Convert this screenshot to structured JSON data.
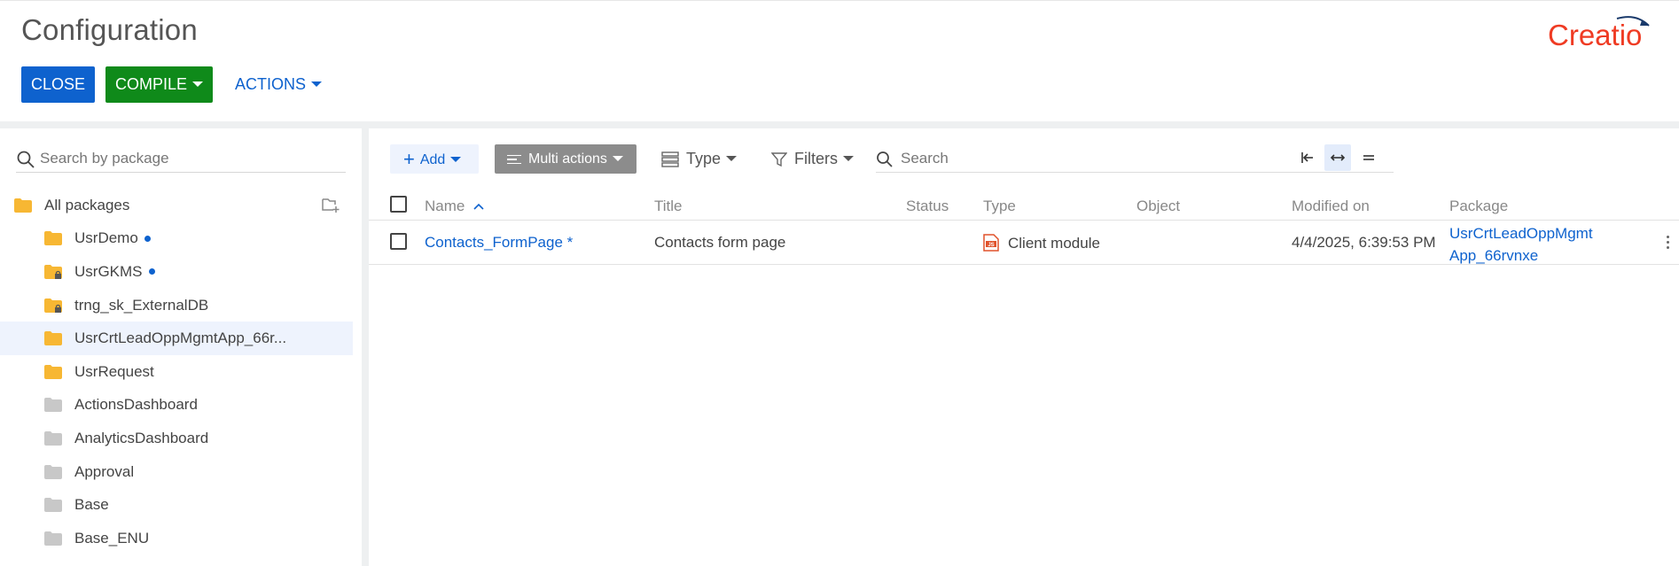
{
  "header": {
    "title": "Configuration",
    "close_label": "CLOSE",
    "compile_label": "COMPILE",
    "actions_label": "ACTIONS",
    "logo_text": "Creatio"
  },
  "sidebar": {
    "search_placeholder": "Search by package",
    "all_packages_label": "All packages",
    "packages": [
      {
        "name": "UsrDemo",
        "dot": true,
        "locked": false,
        "color": "orange",
        "selected": false
      },
      {
        "name": "UsrGKMS",
        "dot": true,
        "locked": true,
        "color": "orange",
        "selected": false
      },
      {
        "name": "trng_sk_ExternalDB",
        "dot": false,
        "locked": true,
        "color": "orange",
        "selected": false
      },
      {
        "name": "UsrCrtLeadOppMgmtApp_66r...",
        "dot": false,
        "locked": false,
        "color": "orange",
        "selected": true
      },
      {
        "name": "UsrRequest",
        "dot": false,
        "locked": false,
        "color": "orange",
        "selected": false
      },
      {
        "name": "ActionsDashboard",
        "dot": false,
        "locked": false,
        "color": "gray",
        "selected": false
      },
      {
        "name": "AnalyticsDashboard",
        "dot": false,
        "locked": false,
        "color": "gray",
        "selected": false
      },
      {
        "name": "Approval",
        "dot": false,
        "locked": false,
        "color": "gray",
        "selected": false
      },
      {
        "name": "Base",
        "dot": false,
        "locked": false,
        "color": "gray",
        "selected": false
      },
      {
        "name": "Base_ENU",
        "dot": false,
        "locked": false,
        "color": "gray",
        "selected": false
      }
    ]
  },
  "toolbar": {
    "add_label": "Add",
    "multi_actions_label": "Multi actions",
    "type_label": "Type",
    "filters_label": "Filters",
    "search_placeholder": "Search"
  },
  "grid": {
    "columns": {
      "name": "Name",
      "title": "Title",
      "status": "Status",
      "type": "Type",
      "object": "Object",
      "modified_on": "Modified on",
      "package": "Package"
    },
    "rows": [
      {
        "name": "Contacts_FormPage *",
        "title": "Contacts form page",
        "status": "",
        "type": "Client module",
        "object": "",
        "modified_on": "4/4/2025, 6:39:53 PM",
        "package_line1": "UsrCrtLeadOppMgmt",
        "package_line2": "App_66rvnxe"
      }
    ]
  },
  "colors": {
    "primary_blue": "#0e62ce",
    "compile_green": "#0f8a1a",
    "multi_actions_gray": "#8c8c8c",
    "folder_orange": "#f7b733",
    "folder_gray": "#c8c8c8",
    "logo_red": "#ef3b23",
    "selected_row": "#eef3fd"
  }
}
